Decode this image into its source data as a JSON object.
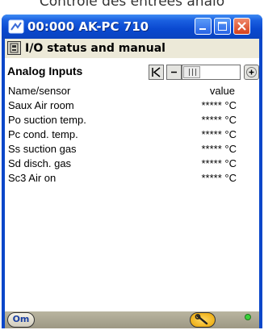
{
  "caption": "Contrôle des entrées analo",
  "window": {
    "title": "00:000 AK-PC 710"
  },
  "menubar": {
    "title": "I/O status and manual"
  },
  "section": {
    "title": "Analog Inputs",
    "nav": {
      "first": "|<",
      "prev": "<",
      "next": "+",
      "position_fraction": 0.3
    }
  },
  "table": {
    "header": {
      "name": "Name/sensor",
      "value": "value"
    },
    "rows": [
      {
        "name": "Saux Air room",
        "value": "***** °C"
      },
      {
        "name": "Po suction temp.",
        "value": "***** °C"
      },
      {
        "name": "Pc cond. temp.",
        "value": "***** °C"
      },
      {
        "name": "Ss suction gas",
        "value": "***** °C"
      },
      {
        "name": "Sd disch. gas",
        "value": "***** °C"
      },
      {
        "name": "Sc3 Air on",
        "value": "***** °C"
      }
    ]
  },
  "bottombar": {
    "left_button": "Om",
    "wrench_icon": "wrench-icon",
    "status": "green"
  },
  "colors": {
    "titlebar": "#0a49d0",
    "window_border": "#0a47c9",
    "close_button": "#d5401c",
    "status_led": "#3bd13b",
    "wrench_button": "#e8a300"
  }
}
